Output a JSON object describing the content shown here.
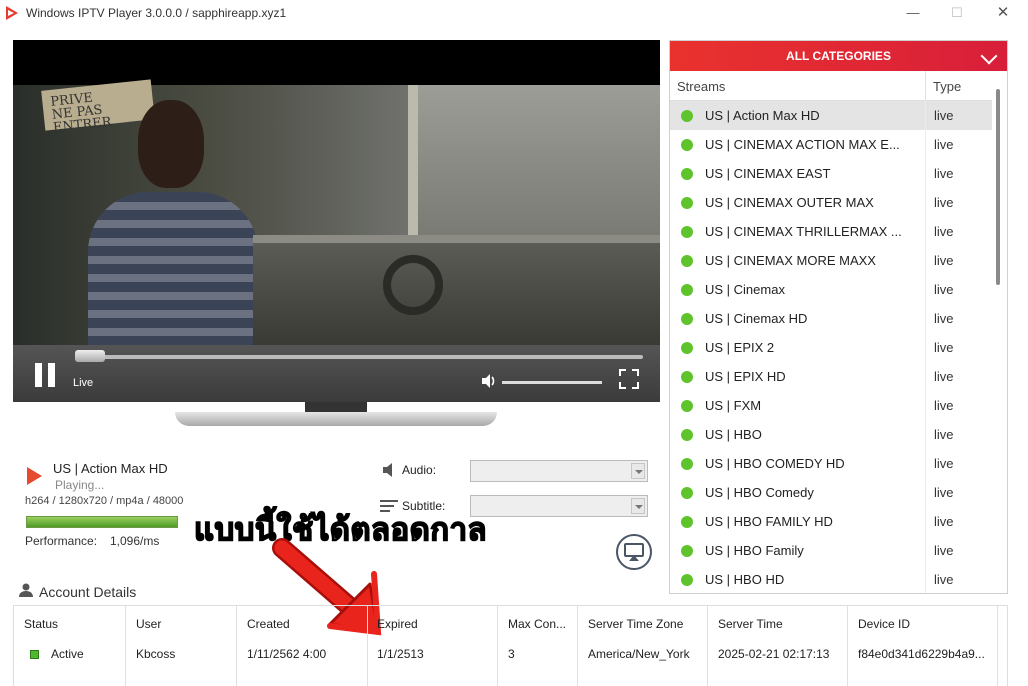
{
  "window": {
    "title": "Windows IPTV Player 3.0.0.0 / sapphireapp.xyz1",
    "minimize": "—",
    "maximize": "☐",
    "close": "✕"
  },
  "video": {
    "sign_text": "PRIVE\nNE PAS ENTRER",
    "live_label": "Live",
    "seek_progress": 0.04,
    "volume_level": 0.98
  },
  "now_playing": {
    "channel": "US | Action Max HD",
    "status": "Playing...",
    "codec": "h264 / 1280x720 / mp4a / 48000",
    "performance_label": "Performance:",
    "performance_value": "1,096/ms",
    "performance_level": 1.0
  },
  "audio": {
    "label": "Audio:",
    "value": ""
  },
  "subtitle": {
    "label": "Subtitle:",
    "value": ""
  },
  "overlay": {
    "thai_text": "แบบนี้ใช้ได้ตลอดกาล",
    "arrow_color": "#e8241c"
  },
  "account": {
    "title": "Account Details",
    "columns": [
      {
        "header": "Status",
        "value": "Active"
      },
      {
        "header": "User",
        "value": "Kbcoss"
      },
      {
        "header": "Created",
        "value": "1/11/2562 4:00"
      },
      {
        "header": "Expired",
        "value": "1/1/2513"
      },
      {
        "header": "Max Con...",
        "value": "3"
      },
      {
        "header": "Server Time Zone",
        "value": "America/New_York"
      },
      {
        "header": "Server Time",
        "value": "2025-02-21 02:17:13"
      },
      {
        "header": "Device ID",
        "value": "f84e0d341d6229b4a9..."
      }
    ]
  },
  "categories": {
    "header": "ALL CATEGORIES",
    "col_streams": "Streams",
    "col_type": "Type",
    "status_color": "#5fc42b",
    "accent_color": "#e42a33",
    "streams": [
      {
        "name": "US | Action Max HD",
        "type": "live",
        "selected": true
      },
      {
        "name": "US | CINEMAX ACTION MAX E...",
        "type": "live"
      },
      {
        "name": "US | CINEMAX EAST",
        "type": "live"
      },
      {
        "name": "US | CINEMAX OUTER MAX",
        "type": "live"
      },
      {
        "name": "US | CINEMAX THRILLERMAX ...",
        "type": "live"
      },
      {
        "name": "US | CINEMAX MORE MAXX",
        "type": "live"
      },
      {
        "name": "US | Cinemax",
        "type": "live"
      },
      {
        "name": "US | Cinemax HD",
        "type": "live"
      },
      {
        "name": "US | EPIX 2",
        "type": "live"
      },
      {
        "name": "US | EPIX HD",
        "type": "live"
      },
      {
        "name": "US | FXM",
        "type": "live"
      },
      {
        "name": "US | HBO",
        "type": "live"
      },
      {
        "name": "US | HBO COMEDY HD",
        "type": "live"
      },
      {
        "name": "US | HBO Comedy",
        "type": "live"
      },
      {
        "name": "US | HBO FAMILY HD",
        "type": "live"
      },
      {
        "name": "US | HBO Family",
        "type": "live"
      },
      {
        "name": "US | HBO HD",
        "type": "live"
      }
    ]
  }
}
